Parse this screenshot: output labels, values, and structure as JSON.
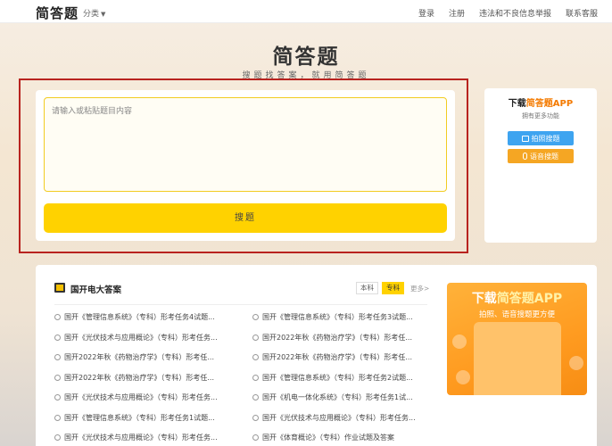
{
  "header": {
    "logo": "简答题",
    "category_label": "分类",
    "nav": [
      "登录",
      "注册",
      "违法和不良信息举报",
      "联系客服"
    ]
  },
  "hero": {
    "title": "简答题",
    "subtitle": "搜题找答案，就用简答题"
  },
  "search": {
    "placeholder": "请输入或粘贴题目内容",
    "button_label": "搜题"
  },
  "app_card": {
    "title_prefix": "下载",
    "title_accent": "简答题APP",
    "subtitle": "拥有更多功能",
    "photo_button": "拍照搜题",
    "voice_button": "语音搜题"
  },
  "section": {
    "title": "国开电大答案",
    "tags": [
      "本科",
      "专科"
    ],
    "active_tag": "专科",
    "more": "更多>"
  },
  "questions_left": [
    "国开《管理信息系统》（专科）形考任务4试题...",
    "国开《光伏技术与应用概论》（专科）形考任务...",
    "国开2022年秋《药物治疗学》（专科）形考任...",
    "国开2022年秋《药物治疗学》（专科）形考任...",
    "国开《光伏技术与应用概论》（专科）形考任务...",
    "国开《管理信息系统》（专科）形考任务1试题...",
    "国开《光伏技术与应用概论》（专科）形考任务..."
  ],
  "questions_right": [
    "国开《管理信息系统》（专科）形考任务3试题...",
    "国开2022年秋《药物治疗学》（专科）形考任...",
    "国开2022年秋《药物治疗学》（专科）形考任...",
    "国开《管理信息系统》（专科）形考任务2试题...",
    "国开《机电一体化系统》（专科）形考任务1试...",
    "国开《光伏技术与应用概论》（专科）形考任务...",
    "国开《体育概论》（专科）作业试题及答案"
  ],
  "promo": {
    "title_prefix": "下载",
    "title_accent": "简答题APP",
    "subtitle": "拍照、语音搜题更方便"
  },
  "colors": {
    "brand_yellow": "#ffd200",
    "accent_orange": "#f47a00",
    "highlight_red": "#b8231f",
    "photo_blue": "#3ea4f0",
    "voice_orange": "#f5a623"
  }
}
